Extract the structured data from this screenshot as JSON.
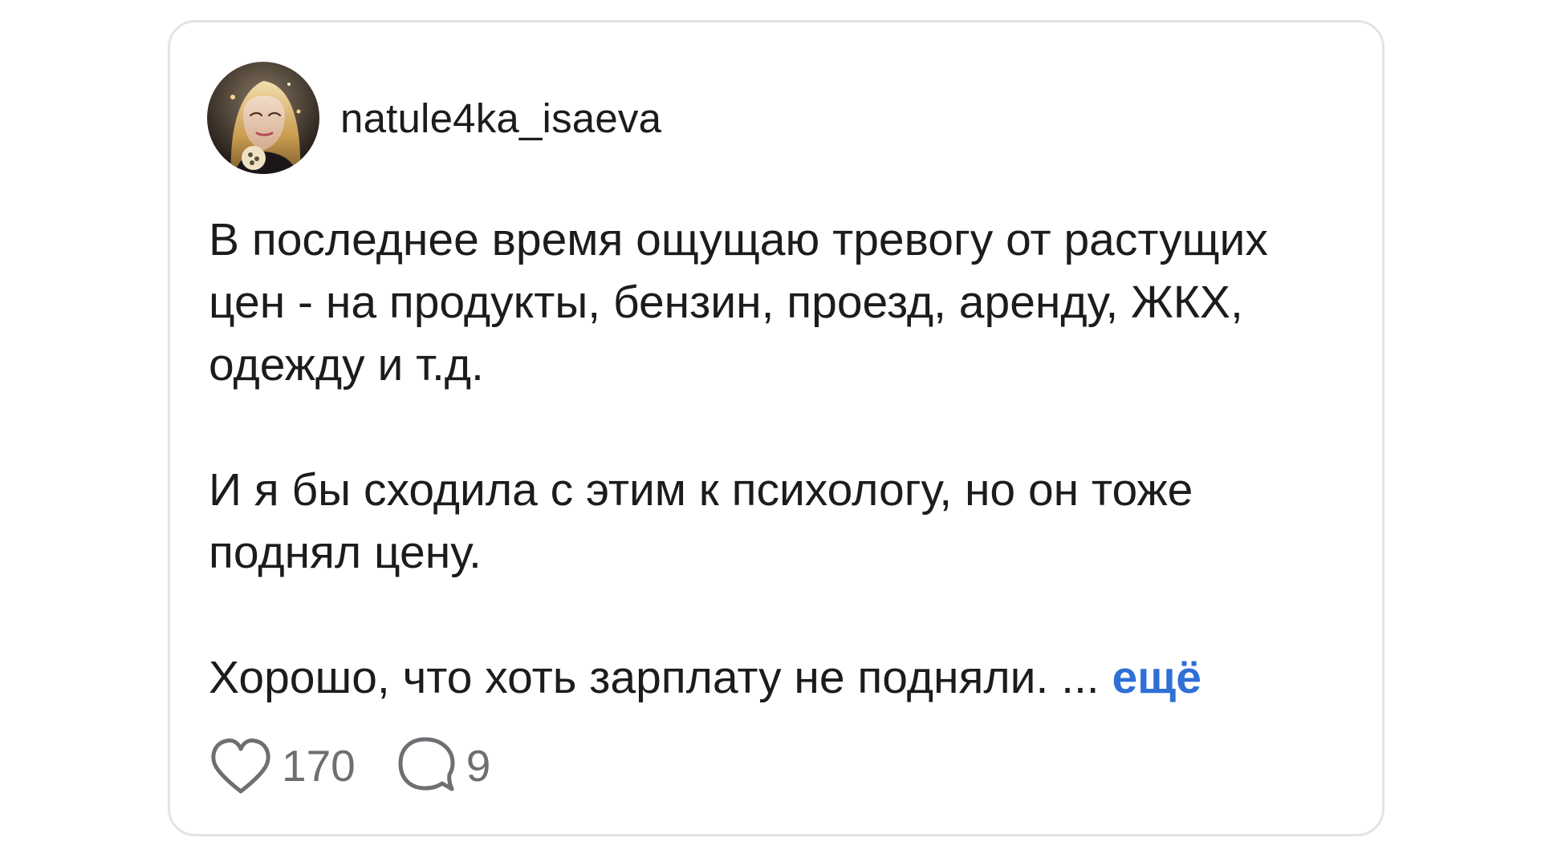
{
  "post": {
    "username": "natule4ka_isaeva",
    "paragraph1": "В последнее время ощущаю тревогу от растущих цен - на продукты, бензин, проезд, аренду, ЖКХ, одежду и т.д.",
    "paragraph2": "И я бы сходила с этим к психологу, но он тоже поднял цену.",
    "paragraph3": "Хорошо, что хоть зарплату не подняли. ...",
    "more_label": "ещё",
    "likes": "170",
    "comments": "9"
  },
  "icons": {
    "like": "heart-icon",
    "comment": "speech-bubble-icon"
  },
  "colors": {
    "text": "#1c1c1e",
    "muted": "#6e6e73",
    "link": "#2f6fd6",
    "border": "#e3e3e8"
  }
}
